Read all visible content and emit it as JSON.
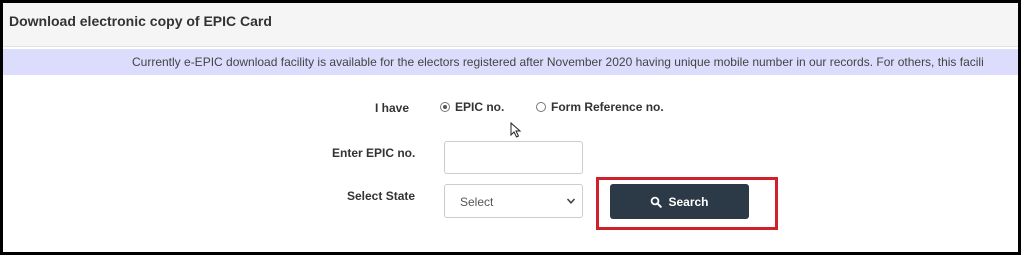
{
  "header": {
    "title": "Download electronic copy of EPIC Card"
  },
  "banner": {
    "text": "Currently e-EPIC download facility is available for the electors registered after November 2020 having unique mobile number in our records. For others, this facili"
  },
  "form": {
    "i_have_label": "I have",
    "options": [
      {
        "label": "EPIC no.",
        "selected": true
      },
      {
        "label": "Form Reference no.",
        "selected": false
      }
    ],
    "epic_label": "Enter EPIC no.",
    "epic_value": "",
    "state_label": "Select State",
    "state_value": "Select",
    "search_label": "Search"
  },
  "colors": {
    "banner_bg": "#dcdcfc",
    "button_bg": "#2b3a46",
    "highlight": "#d0202a"
  }
}
